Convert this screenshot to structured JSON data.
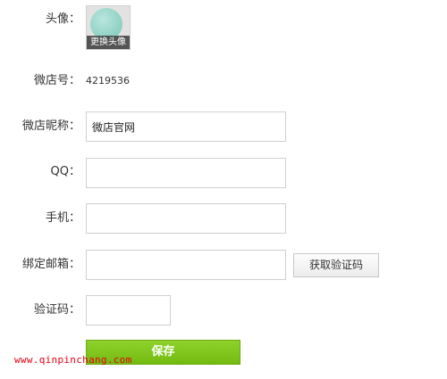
{
  "form": {
    "avatar": {
      "label": "头像：",
      "change_label": "更换头像"
    },
    "shop_id": {
      "label": "微店号：",
      "value": "4219536"
    },
    "shop_name": {
      "label": "微店昵称：",
      "value": "微店官网"
    },
    "qq": {
      "label": "QQ：",
      "value": ""
    },
    "phone": {
      "label": "手机：",
      "value": ""
    },
    "email": {
      "label": "绑定邮箱：",
      "value": "",
      "get_code_label": "获取验证码"
    },
    "verify_code": {
      "label": "验证码：",
      "value": ""
    },
    "save_label": "保存"
  },
  "watermark": "www.qinpinchang.com",
  "colors": {
    "save_button": "#7ac11a",
    "watermark": "#e60012",
    "avatar": "#93d3c6"
  }
}
